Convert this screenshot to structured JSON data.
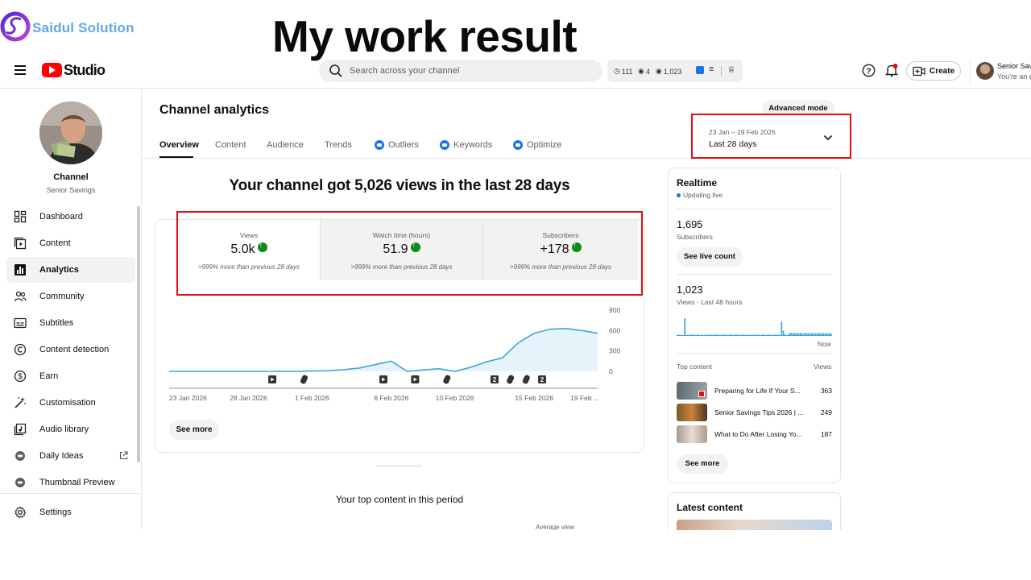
{
  "overlay": {
    "brand_name": "Saidul Solution",
    "headline": "My work result"
  },
  "topbar": {
    "studio_label": "Studio",
    "search_placeholder": "Search across your channel",
    "stats": {
      "watch_count": "111",
      "eye_count": "4",
      "views_count": "1,023"
    },
    "create_label": "Create",
    "account_name": "Senior Savi",
    "account_sub": "You're an ed"
  },
  "sidebar": {
    "channel_label": "Channel",
    "channel_name": "Senior Savings",
    "items": [
      {
        "label": "Dashboard",
        "icon": "dashboard-icon"
      },
      {
        "label": "Content",
        "icon": "content-icon"
      },
      {
        "label": "Analytics",
        "icon": "analytics-icon",
        "active": true
      },
      {
        "label": "Community",
        "icon": "community-icon"
      },
      {
        "label": "Subtitles",
        "icon": "subtitles-icon"
      },
      {
        "label": "Content detection",
        "icon": "copyright-icon"
      },
      {
        "label": "Earn",
        "icon": "earn-icon"
      },
      {
        "label": "Customisation",
        "icon": "wand-icon"
      },
      {
        "label": "Audio library",
        "icon": "audio-library-icon"
      },
      {
        "label": "Daily Ideas",
        "icon": "extension-icon"
      },
      {
        "label": "Thumbnail Preview",
        "icon": "extension-icon"
      }
    ],
    "settings_label": "Settings"
  },
  "main": {
    "page_title": "Channel analytics",
    "advanced_mode_label": "Advanced mode",
    "tabs": [
      {
        "label": "Overview",
        "active": true
      },
      {
        "label": "Content"
      },
      {
        "label": "Audience"
      },
      {
        "label": "Trends"
      },
      {
        "label": "Outliers",
        "badge": true
      },
      {
        "label": "Keywords",
        "badge": true
      },
      {
        "label": "Optimize",
        "badge": true
      }
    ],
    "date_range": "23 Jan – 19 Feb 2026",
    "date_period": "Last 28 days",
    "views_headline": "Your channel got 5,026 views in the last 28 days",
    "metrics": [
      {
        "label": "Views",
        "value": "5.0k",
        "note": ">999% more than previous 28 days"
      },
      {
        "label": "Watch time (hours)",
        "value": "51.9",
        "note": ">999% more than previous 28 days"
      },
      {
        "label": "Subscribers",
        "value": "+178",
        "note": ">999% more than previous 28 days"
      }
    ],
    "see_more_label": "See more",
    "top_content_title": "Your top content in this period",
    "avg_view_label": "Average view"
  },
  "chart_data": {
    "type": "area",
    "x": [
      "23 Jan 2026",
      "24 Jan",
      "25 Jan",
      "26 Jan",
      "27 Jan",
      "28 Jan 2026",
      "29 Jan",
      "30 Jan",
      "31 Jan",
      "1 Feb 2026",
      "2 Feb",
      "3 Feb",
      "4 Feb",
      "5 Feb",
      "6 Feb 2026",
      "7 Feb",
      "8 Feb",
      "9 Feb",
      "10 Feb 2026",
      "11 Feb",
      "12 Feb",
      "13 Feb",
      "14 Feb",
      "15 Feb 2026",
      "16 Feb",
      "17 Feb",
      "18 Feb",
      "19 Feb 2026"
    ],
    "values": [
      0,
      0,
      0,
      0,
      0,
      0,
      0,
      0,
      0,
      5,
      10,
      25,
      50,
      100,
      150,
      0,
      20,
      40,
      0,
      60,
      140,
      200,
      420,
      560,
      620,
      630,
      600,
      560
    ],
    "tick_labels": [
      "23 Jan 2026",
      "28 Jan 2026",
      "1 Feb 2026",
      "6 Feb 2026",
      "10 Feb 2026",
      "15 Feb 2026",
      "19 Feb ..."
    ],
    "y_ticks": [
      "900",
      "600",
      "300",
      "0"
    ],
    "ylim": [
      0,
      900
    ],
    "line_color": "#3ea6d8",
    "fill_color": "#e6f3fa",
    "markers": [
      {
        "x_index": 6.5,
        "kind": "video"
      },
      {
        "x_index": 8.5,
        "kind": "short"
      },
      {
        "x_index": 13.5,
        "kind": "video"
      },
      {
        "x_index": 15.5,
        "kind": "video"
      },
      {
        "x_index": 17.5,
        "kind": "short"
      },
      {
        "x_index": 20.5,
        "kind": "count",
        "label": "2"
      },
      {
        "x_index": 21.5,
        "kind": "short"
      },
      {
        "x_index": 22.5,
        "kind": "short"
      },
      {
        "x_index": 23.5,
        "kind": "count",
        "label": "2"
      }
    ]
  },
  "realtime": {
    "title": "Realtime",
    "status": "Updating live",
    "subscribers_value": "1,695",
    "subscribers_label": "Subscribers",
    "live_count_label": "See live count",
    "views_value": "1,023",
    "views_label": "Views · Last 48 hours",
    "now_label": "Now",
    "top_content_label": "Top content",
    "views_col_label": "Views",
    "bars": [
      0.08,
      0.05,
      0.07,
      0.03,
      1.0,
      0.06,
      0.05,
      0.08,
      0.07,
      0.06,
      0.05,
      0.09,
      0.04,
      0.06,
      0.05,
      0.07,
      0.05,
      0.08,
      0.06,
      0.05,
      0.09,
      0.07,
      0.06,
      0.05,
      0.08,
      0.07,
      0.06,
      0.05,
      0.09,
      0.06,
      0.05,
      0.08,
      0.06,
      0.07,
      0.05,
      0.08,
      0.06,
      0.05,
      0.07,
      0.06,
      0.05,
      0.08,
      0.06,
      0.07,
      0.05,
      0.08,
      0.06,
      0.05,
      0.07,
      0.06,
      0.05,
      0.08,
      0.06,
      0.07,
      0.05,
      0.8,
      0.3,
      0.08,
      0.05,
      0.15,
      0.18,
      0.16,
      0.17,
      0.15,
      0.16,
      0.17,
      0.15,
      0.16,
      0.17,
      0.15,
      0.16,
      0.15,
      0.16,
      0.15,
      0.16,
      0.15,
      0.16,
      0.15,
      0.16,
      0.15,
      0.16,
      0.15
    ],
    "top_items": [
      {
        "title": "Preparing for Life If Your S...",
        "views": "363",
        "thumb": "#5e6a70"
      },
      {
        "title": "Senior Savings Tips 2026 | ...",
        "views": "249",
        "thumb": "#7a5a2e"
      },
      {
        "title": "What to Do After Losing Yo...",
        "views": "187",
        "thumb": "#a89a90"
      }
    ],
    "see_more_label": "See more"
  },
  "latest": {
    "title": "Latest content"
  },
  "colors": {
    "highlight_red": "#e01010",
    "accent_blue": "#1a73e8",
    "growth_green": "#0e8a16",
    "youtube_red": "#ff0000"
  }
}
